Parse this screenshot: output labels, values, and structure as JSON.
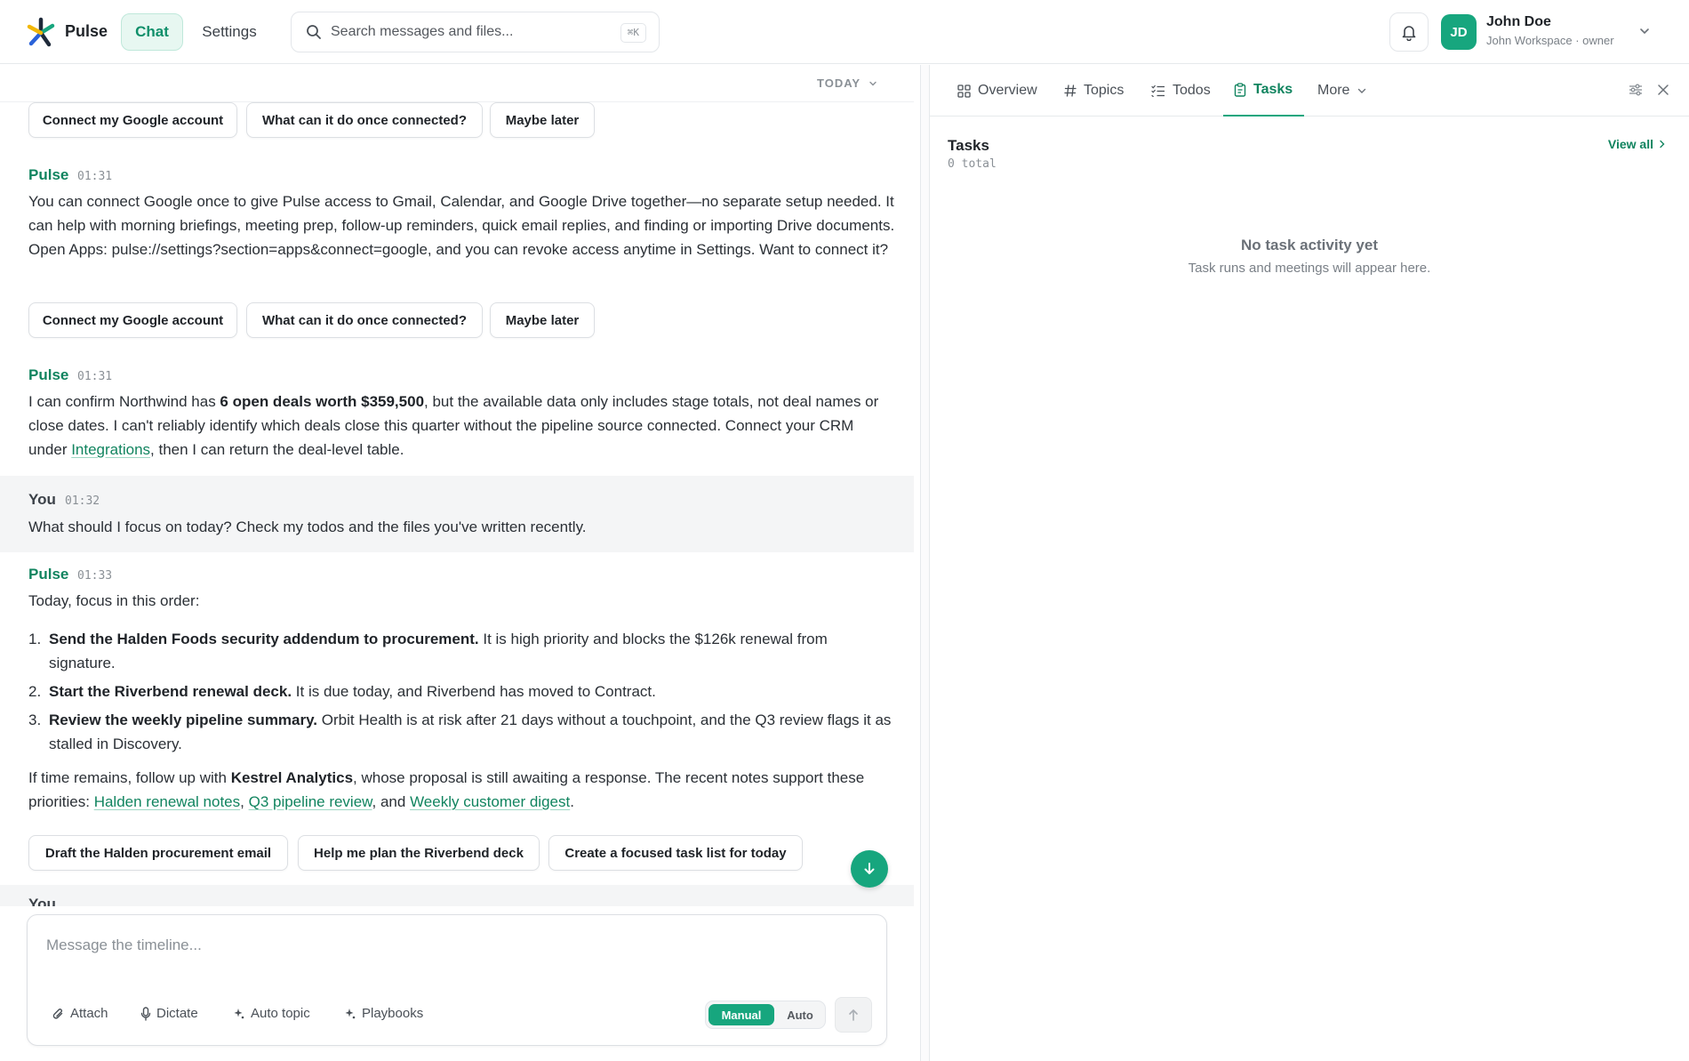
{
  "header": {
    "brand": "Pulse",
    "nav": {
      "chat": "Chat",
      "settings": "Settings"
    },
    "search": {
      "placeholder": "Search messages and files...",
      "shortcut": "⌘K"
    },
    "user": {
      "initials": "JD",
      "name": "John Doe",
      "org": "John Workspace · owner"
    }
  },
  "chat": {
    "day_label": "TODAY",
    "chips_row1": [
      "Connect my Google account",
      "What can it do once connected?",
      "Maybe later"
    ],
    "msg1": {
      "sender": "Pulse",
      "time": "01:31",
      "text": "You can connect Google once to give Pulse access to Gmail, Calendar, and Google Drive together—no separate setup needed. It can help with morning briefings, meeting prep, follow-up reminders, quick email replies, and finding or importing Drive documents. Open Apps: pulse://settings?section=apps&connect=google, and you can revoke access anytime in Settings. Want to connect it?"
    },
    "chips_row2": [
      "Connect my Google account",
      "What can it do once connected?",
      "Maybe later"
    ],
    "msg2": {
      "sender": "Pulse",
      "time": "01:31",
      "t1": "I can confirm Northwind has ",
      "b1": "6 open deals worth $359,500",
      "t2": ", but the available data only includes stage totals, not deal names or close dates. I can't reliably identify which deals close this quarter without the pipeline source connected. Connect your CRM under ",
      "link": "Integrations",
      "t3": ", then I can return the deal-level table."
    },
    "msg3": {
      "sender": "You",
      "time": "01:32",
      "text": "What should I focus on today? Check my todos and the files you've written recently."
    },
    "msg4": {
      "sender": "Pulse",
      "time": "01:33",
      "intro": "Today, focus in this order:",
      "items": [
        {
          "num": "1.",
          "bold": "Send the Halden Foods security addendum to procurement.",
          "text": " It is high priority and blocks the $126k renewal from signature."
        },
        {
          "num": "2.",
          "bold": "Start the Riverbend renewal deck.",
          "text": " It is due today, and Riverbend has moved to Contract."
        },
        {
          "num": "3.",
          "bold": "Review the weekly pipeline summary.",
          "text": " Orbit Health is at risk after 21 days without a touchpoint, and the Q3 review flags it as stalled in Discovery."
        }
      ],
      "o1": "If time remains, follow up with ",
      "ob": "Kestrel Analytics",
      "o2": ", whose proposal is still awaiting a response. The recent notes support these priorities: ",
      "l1": "Halden renewal notes",
      "c1": ", ",
      "l2": "Q3 pipeline review",
      "c2": ", and ",
      "l3": "Weekly customer digest",
      "end": "."
    },
    "chips_row3": [
      "Draft the Halden procurement email",
      "Help me plan the Riverbend deck",
      "Create a focused task list for today"
    ],
    "next_sender_partial": "You"
  },
  "composer": {
    "placeholder": "Message the timeline...",
    "tools": [
      "Attach",
      "Dictate",
      "Auto topic",
      "Playbooks"
    ],
    "mode_on": "Manual",
    "mode_off": "Auto"
  },
  "side": {
    "tabs": [
      "Overview",
      "Topics",
      "Todos",
      "Tasks",
      "More"
    ],
    "title": "Tasks",
    "count": "0 total",
    "view_all": "View all",
    "empty_title": "No task activity yet",
    "empty_sub": "Task runs and meetings will appear here."
  },
  "colors": {
    "accent": "#17a67e",
    "accent_text": "#11845f",
    "muted_bg": "#f4f5f6"
  }
}
